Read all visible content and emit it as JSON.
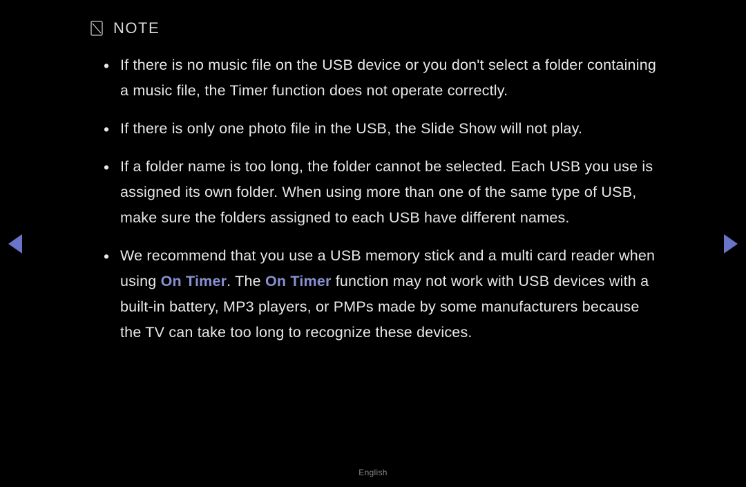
{
  "note": {
    "title": "NOTE",
    "items": [
      {
        "segments": [
          {
            "text": "If there is no music file on the USB device or you don't select a folder containing a music file, the Timer function does not operate correctly.",
            "highlight": false
          }
        ]
      },
      {
        "segments": [
          {
            "text": "If there is only one photo file in the USB, the Slide Show will not play.",
            "highlight": false
          }
        ]
      },
      {
        "segments": [
          {
            "text": "If a folder name is too long, the folder cannot be selected. Each USB you use is assigned its own folder. When using more than one of the same type of USB, make sure the folders assigned to each USB have different names.",
            "highlight": false
          }
        ]
      },
      {
        "segments": [
          {
            "text": "We recommend that you use a USB memory stick and a multi card reader when using ",
            "highlight": false
          },
          {
            "text": "On Timer",
            "highlight": true
          },
          {
            "text": ". The ",
            "highlight": false
          },
          {
            "text": "On Timer",
            "highlight": true
          },
          {
            "text": " function may not work with USB devices with a built-in battery, MP3 players, or PMPs made by some manufacturers because the TV can take too long to recognize these devices.",
            "highlight": false
          }
        ]
      }
    ]
  },
  "footer": {
    "language": "English"
  }
}
